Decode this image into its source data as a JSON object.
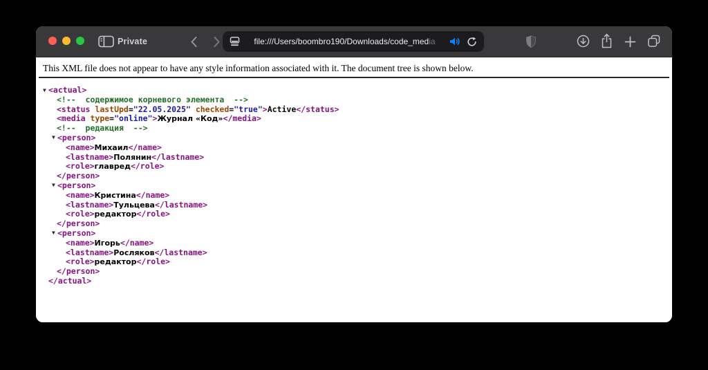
{
  "toolbar": {
    "private_label": "Private",
    "url": "file:///Users/boombro190/Downloads/code_med",
    "url_fade": "ia"
  },
  "notice": {
    "text": "This XML file does not appear to have any style information associated with it. The document tree is shown below."
  },
  "colors": {
    "tag": "#881280",
    "attr": "#994500",
    "val": "#1A1AA6",
    "comment": "#236E25",
    "accent": "#0A84FF"
  },
  "xml": {
    "lines": [
      {
        "indent": 8,
        "arrow": true,
        "tokens": [
          {
            "c": "tag",
            "s": "<actual>"
          }
        ]
      },
      {
        "indent": 20,
        "arrow": false,
        "tokens": [
          {
            "c": "comment",
            "s": "<!--  содержимое корневого элемента  -->"
          }
        ]
      },
      {
        "indent": 20,
        "arrow": false,
        "tokens": [
          {
            "c": "tag",
            "s": "<status"
          },
          {
            "c": "attr",
            "s": " lastUpd"
          },
          {
            "c": "eq",
            "s": "="
          },
          {
            "c": "val",
            "s": "\"22.05.2025\""
          },
          {
            "c": "attr",
            "s": " checked"
          },
          {
            "c": "eq",
            "s": "="
          },
          {
            "c": "val",
            "s": "\"true\""
          },
          {
            "c": "tag",
            "s": ">"
          },
          {
            "c": "text",
            "s": "Active"
          },
          {
            "c": "tag",
            "s": "</status>"
          }
        ]
      },
      {
        "indent": 20,
        "arrow": false,
        "tokens": [
          {
            "c": "tag",
            "s": "<media"
          },
          {
            "c": "attr",
            "s": " type"
          },
          {
            "c": "eq",
            "s": "="
          },
          {
            "c": "val",
            "s": "\"online\""
          },
          {
            "c": "tag",
            "s": ">"
          },
          {
            "c": "text",
            "s": "Журнал «Код»"
          },
          {
            "c": "tag",
            "s": "</media>"
          }
        ]
      },
      {
        "indent": 20,
        "arrow": false,
        "tokens": [
          {
            "c": "comment",
            "s": "<!--  редакция  -->"
          }
        ]
      },
      {
        "indent": 21,
        "arrow": true,
        "tokens": [
          {
            "c": "tag",
            "s": "<person>"
          }
        ]
      },
      {
        "indent": 33,
        "arrow": false,
        "tokens": [
          {
            "c": "tag",
            "s": "<name>"
          },
          {
            "c": "text",
            "s": "Михаил"
          },
          {
            "c": "tag",
            "s": "</name>"
          }
        ]
      },
      {
        "indent": 33,
        "arrow": false,
        "tokens": [
          {
            "c": "tag",
            "s": "<lastname>"
          },
          {
            "c": "text",
            "s": "Полянин"
          },
          {
            "c": "tag",
            "s": "</lastname>"
          }
        ]
      },
      {
        "indent": 33,
        "arrow": false,
        "tokens": [
          {
            "c": "tag",
            "s": "<role>"
          },
          {
            "c": "text",
            "s": "главред"
          },
          {
            "c": "tag",
            "s": "</role>"
          }
        ]
      },
      {
        "indent": 20,
        "arrow": false,
        "tokens": [
          {
            "c": "tag",
            "s": "</person>"
          }
        ]
      },
      {
        "indent": 21,
        "arrow": true,
        "tokens": [
          {
            "c": "tag",
            "s": "<person>"
          }
        ]
      },
      {
        "indent": 33,
        "arrow": false,
        "tokens": [
          {
            "c": "tag",
            "s": "<name>"
          },
          {
            "c": "text",
            "s": "Кристина"
          },
          {
            "c": "tag",
            "s": "</name>"
          }
        ]
      },
      {
        "indent": 33,
        "arrow": false,
        "tokens": [
          {
            "c": "tag",
            "s": "<lastname>"
          },
          {
            "c": "text",
            "s": "Тульцева"
          },
          {
            "c": "tag",
            "s": "</lastname>"
          }
        ]
      },
      {
        "indent": 33,
        "arrow": false,
        "tokens": [
          {
            "c": "tag",
            "s": "<role>"
          },
          {
            "c": "text",
            "s": "редактор"
          },
          {
            "c": "tag",
            "s": "</role>"
          }
        ]
      },
      {
        "indent": 20,
        "arrow": false,
        "tokens": [
          {
            "c": "tag",
            "s": "</person>"
          }
        ]
      },
      {
        "indent": 21,
        "arrow": true,
        "tokens": [
          {
            "c": "tag",
            "s": "<person>"
          }
        ]
      },
      {
        "indent": 33,
        "arrow": false,
        "tokens": [
          {
            "c": "tag",
            "s": "<name>"
          },
          {
            "c": "text",
            "s": "Игорь"
          },
          {
            "c": "tag",
            "s": "</name>"
          }
        ]
      },
      {
        "indent": 33,
        "arrow": false,
        "tokens": [
          {
            "c": "tag",
            "s": "<lastname>"
          },
          {
            "c": "text",
            "s": "Росляков"
          },
          {
            "c": "tag",
            "s": "</lastname>"
          }
        ]
      },
      {
        "indent": 33,
        "arrow": false,
        "tokens": [
          {
            "c": "tag",
            "s": "<role>"
          },
          {
            "c": "text",
            "s": "редактор"
          },
          {
            "c": "tag",
            "s": "</role>"
          }
        ]
      },
      {
        "indent": 20,
        "arrow": false,
        "tokens": [
          {
            "c": "tag",
            "s": "</person>"
          }
        ]
      },
      {
        "indent": 8,
        "arrow": false,
        "tokens": [
          {
            "c": "tag",
            "s": "</actual>"
          }
        ]
      }
    ]
  }
}
